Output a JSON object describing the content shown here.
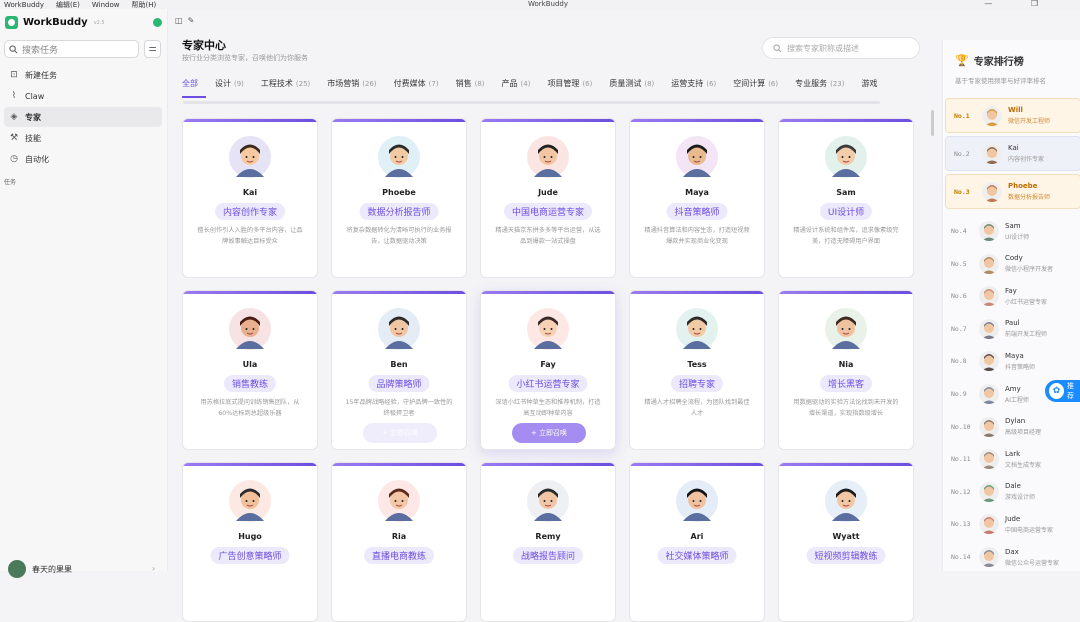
{
  "menubar": {
    "app": "WorkBuddy",
    "edit": "编辑(E)",
    "window": "Window",
    "help": "帮助(H)",
    "title": "WorkBuddy"
  },
  "sidebar": {
    "brand": "WorkBuddy",
    "version": "v2.5",
    "search_placeholder": "搜索任务",
    "items": [
      {
        "label": "新建任务",
        "icon": "new-task-icon"
      },
      {
        "label": "Claw",
        "icon": "claw-icon"
      },
      {
        "label": "专家",
        "icon": "expert-icon"
      },
      {
        "label": "技能",
        "icon": "skill-icon"
      },
      {
        "label": "自动化",
        "icon": "clock-icon"
      }
    ],
    "section": "任务",
    "user": "春天的果果"
  },
  "header": {
    "title": "专家中心",
    "subtitle": "按行业分类浏览专家，召唤他们为你服务",
    "search_placeholder": "搜索专家职称或描述"
  },
  "tabs": [
    {
      "label": "全部",
      "count": ""
    },
    {
      "label": "设计",
      "count": "(9)"
    },
    {
      "label": "工程技术",
      "count": "(25)"
    },
    {
      "label": "市场营销",
      "count": "(26)"
    },
    {
      "label": "付费媒体",
      "count": "(7)"
    },
    {
      "label": "销售",
      "count": "(8)"
    },
    {
      "label": "产品",
      "count": "(4)"
    },
    {
      "label": "项目管理",
      "count": "(6)"
    },
    {
      "label": "质量测试",
      "count": "(8)"
    },
    {
      "label": "运营支持",
      "count": "(6)"
    },
    {
      "label": "空间计算",
      "count": "(6)"
    },
    {
      "label": "专业服务",
      "count": "(23)"
    },
    {
      "label": "游戏",
      "count": ""
    }
  ],
  "cards": [
    {
      "name": "Kai",
      "role": "内容创作专家",
      "desc": "擅长创作引人入胜的多平台内容，让品牌故事触达目标受众"
    },
    {
      "name": "Phoebe",
      "role": "数据分析报告师",
      "desc": "将复杂数据转化为清晰可执行的业务报告，让数据驱动决策"
    },
    {
      "name": "Jude",
      "role": "中国电商运营专家",
      "desc": "精通天猫京东拼多多等平台运营，从选品到爆款一站式操盘"
    },
    {
      "name": "Maya",
      "role": "抖音策略师",
      "desc": "精通抖音算法和内容生态，打造短视频爆款并实现商业化变现"
    },
    {
      "name": "Sam",
      "role": "UI设计师",
      "desc": "精通设计系统和组件库，追求像素级完美，打造无障碍用户界面"
    },
    {
      "name": "Ula",
      "role": "销售教练",
      "desc": "用苏格拉底式提问训练销售团队，从60%达标到总超级乐器"
    },
    {
      "name": "Ben",
      "role": "品牌策略师",
      "desc": "15年品牌战略经验，守护品牌一致性的终极捍卫者"
    },
    {
      "name": "Fay",
      "role": "小红书运营专家",
      "desc": "深谙小红书种草生态和推荐机制，打造高互动即种草内容"
    },
    {
      "name": "Tess",
      "role": "招聘专家",
      "desc": "精通人才招聘全流程，为团队找到最佳人才"
    },
    {
      "name": "Nia",
      "role": "增长黑客",
      "desc": "用数据驱动的实验方法论找到未开发的增长渠道，实现指数级增长"
    },
    {
      "name": "Hugo",
      "role": "广告创意策略师",
      "desc": ""
    },
    {
      "name": "Ria",
      "role": "直播电商教练",
      "desc": ""
    },
    {
      "name": "Remy",
      "role": "战略报告顾问",
      "desc": ""
    },
    {
      "name": "Ari",
      "role": "社交媒体策略师",
      "desc": ""
    },
    {
      "name": "Wyatt",
      "role": "短视频剪辑教练",
      "desc": ""
    }
  ],
  "call_button": "+ 立即召唤",
  "ranking": {
    "title": "专家排行榜",
    "subtitle": "基于专家使用频率与好评率排名",
    "rows": [
      {
        "no": "No.1",
        "name": "Will",
        "role": "微信开发工程师"
      },
      {
        "no": "No.2",
        "name": "Kai",
        "role": "内容创作专家"
      },
      {
        "no": "No.3",
        "name": "Phoebe",
        "role": "数据分析报告师"
      },
      {
        "no": "No.4",
        "name": "Sam",
        "role": "UI设计师"
      },
      {
        "no": "No.5",
        "name": "Cody",
        "role": "微信小程序开发者"
      },
      {
        "no": "No.6",
        "name": "Fay",
        "role": "小红书运营专家"
      },
      {
        "no": "No.7",
        "name": "Paul",
        "role": "前端开发工程师"
      },
      {
        "no": "No.8",
        "name": "Maya",
        "role": "抖音策略师"
      },
      {
        "no": "No.9",
        "name": "Amy",
        "role": "AI工程师"
      },
      {
        "no": "No.10",
        "name": "Dylan",
        "role": "高级项目经理"
      },
      {
        "no": "No.11",
        "name": "Lark",
        "role": "文档生成专家"
      },
      {
        "no": "No.12",
        "name": "Dale",
        "role": "游戏设计师"
      },
      {
        "no": "No.13",
        "name": "Jude",
        "role": "中国电商运营专家"
      },
      {
        "no": "No.14",
        "name": "Dax",
        "role": "微信公众号运营专家"
      }
    ]
  },
  "float_label": "推荐"
}
